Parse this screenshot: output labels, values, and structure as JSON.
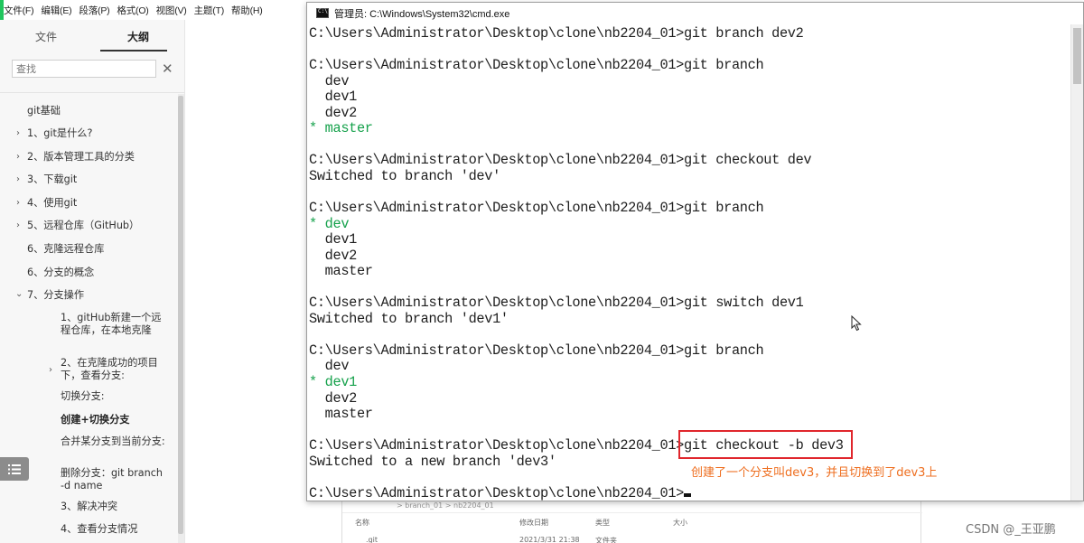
{
  "editor": {
    "menu": [
      "文件(F)",
      "编辑(E)",
      "段落(P)",
      "格式(O)",
      "视图(V)",
      "主题(T)",
      "帮助(H)"
    ],
    "tabs": [
      {
        "label": "文件"
      },
      {
        "label": "大纲"
      }
    ],
    "active_tab": "大纲",
    "search": {
      "placeholder": "查找",
      "value": ""
    },
    "outline": {
      "root": "git基础",
      "items": [
        "1、git是什么?",
        "2、版本管理工具的分类",
        "3、下载git",
        "4、使用git",
        "5、远程仓库（GitHub）",
        "6、克隆远程仓库",
        "6、分支的概念",
        "7、分支操作"
      ],
      "sub_items": [
        "1、gitHub新建一个远程仓库，在本地克隆",
        "2、在克隆成功的项目下，查看分支:",
        "切换分支:",
        "创建+切换分支",
        "合并某分支到当前分支:",
        "删除分支：git branch -d name",
        "3、解决冲突",
        "4、查看分支情况"
      ]
    }
  },
  "cmd": {
    "title": "管理员: C:\\Windows\\System32\\cmd.exe",
    "prompt": "C:\\Users\\Administrator\\Desktop\\clone\\nb2204_01>",
    "lines": [
      {
        "text": "C:\\Users\\Administrator\\Desktop\\clone\\nb2204_01>git branch dev2",
        "color": "normal"
      },
      {
        "text": "",
        "color": "normal"
      },
      {
        "text": "C:\\Users\\Administrator\\Desktop\\clone\\nb2204_01>git branch",
        "color": "normal"
      },
      {
        "text": "  dev",
        "color": "normal"
      },
      {
        "text": "  dev1",
        "color": "normal"
      },
      {
        "text": "  dev2",
        "color": "normal"
      },
      {
        "text": "* master",
        "color": "green"
      },
      {
        "text": "",
        "color": "normal"
      },
      {
        "text": "C:\\Users\\Administrator\\Desktop\\clone\\nb2204_01>git checkout dev",
        "color": "normal"
      },
      {
        "text": "Switched to branch 'dev'",
        "color": "normal"
      },
      {
        "text": "",
        "color": "normal"
      },
      {
        "text": "C:\\Users\\Administrator\\Desktop\\clone\\nb2204_01>git branch",
        "color": "normal"
      },
      {
        "text": "* dev",
        "color": "green"
      },
      {
        "text": "  dev1",
        "color": "normal"
      },
      {
        "text": "  dev2",
        "color": "normal"
      },
      {
        "text": "  master",
        "color": "normal"
      },
      {
        "text": "",
        "color": "normal"
      },
      {
        "text": "C:\\Users\\Administrator\\Desktop\\clone\\nb2204_01>git switch dev1",
        "color": "normal"
      },
      {
        "text": "Switched to branch 'dev1'",
        "color": "normal"
      },
      {
        "text": "",
        "color": "normal"
      },
      {
        "text": "C:\\Users\\Administrator\\Desktop\\clone\\nb2204_01>git branch",
        "color": "normal"
      },
      {
        "text": "  dev",
        "color": "normal"
      },
      {
        "text": "* dev1",
        "color": "green"
      },
      {
        "text": "  dev2",
        "color": "normal"
      },
      {
        "text": "  master",
        "color": "normal"
      },
      {
        "text": "",
        "color": "normal"
      },
      {
        "text": "C:\\Users\\Administrator\\Desktop\\clone\\nb2204_01>git checkout -b dev3",
        "color": "normal"
      },
      {
        "text": "Switched to a new branch 'dev3'",
        "color": "normal"
      },
      {
        "text": "",
        "color": "normal"
      }
    ],
    "final_prompt": "C:\\Users\\Administrator\\Desktop\\clone\\nb2204_01>"
  },
  "annotation": "创建了一个分支叫dev3，并且切换到了dev3上",
  "explorer": {
    "path": "> branch_01 > nb2204_01",
    "columns": [
      "名称",
      "修改日期",
      "类型",
      "大小"
    ],
    "row": {
      "name": ".git",
      "date": "2021/3/31 21:38",
      "type": "文件夹"
    }
  },
  "watermark": "CSDN @_王亚鹏",
  "colors": {
    "green_output": "#15a14b",
    "highlight": "#e0262c",
    "annotation": "#ee6e1f",
    "accent_edge": "#21c55d"
  }
}
